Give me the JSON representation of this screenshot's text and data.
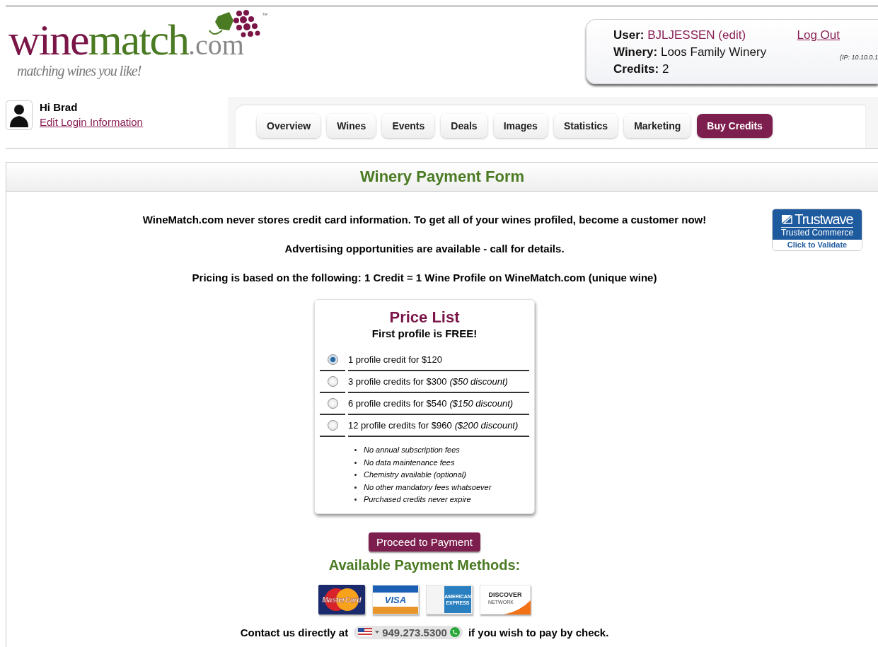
{
  "logo": {
    "wine": "wine",
    "match": "match",
    "com": ".com",
    "tm": "™",
    "tagline": "matching wines you like!"
  },
  "account": {
    "user_label": "User:",
    "user_name": "BJLJESSEN (edit)",
    "winery_label": "Winery:",
    "winery": "Loos Family Winery",
    "credits_label": "Credits:",
    "credits": "2",
    "logout": "Log Out",
    "ip": "(IP: 10.10.0.1"
  },
  "greeting": {
    "hello": "Hi Brad",
    "edit_login": "Edit Login Information"
  },
  "tabs": [
    {
      "label": "Overview",
      "selected": false
    },
    {
      "label": "Wines",
      "selected": false
    },
    {
      "label": "Events",
      "selected": false
    },
    {
      "label": "Deals",
      "selected": false
    },
    {
      "label": "Images",
      "selected": false
    },
    {
      "label": "Statistics",
      "selected": false
    },
    {
      "label": "Marketing",
      "selected": false
    },
    {
      "label": "Buy Credits",
      "selected": true
    }
  ],
  "form_title": "Winery Payment Form",
  "intro": [
    "WineMatch.com never stores credit card information. To get all of your wines profiled, become a customer now!",
    "Advertising opportunities are available - call for details.",
    "Pricing is based on the following: 1 Credit = 1 Wine Profile on WineMatch.com (unique wine)"
  ],
  "trust_badge": {
    "brand": "Trustwave",
    "subtitle": "Trusted Commerce",
    "action": "Click to Validate"
  },
  "price_list": {
    "title": "Price List",
    "subtitle": "First profile is FREE!",
    "options": [
      {
        "text": "1 profile credit for $120",
        "selected": true
      },
      {
        "text": "3 profile credits for $300 *($50 discount)*",
        "selected": false
      },
      {
        "text": "6 profile credits for $540 *($150 discount)*",
        "selected": false
      },
      {
        "text": "12 profile credits for $960 *($200 discount)*",
        "selected": false
      }
    ],
    "features": [
      "No annual subscription fees",
      "No data maintenance fees",
      "Chemistry available (optional)",
      "No other mandatory fees whatsoever",
      "Purchased credits never expire"
    ]
  },
  "proceed_button": "Proceed to Payment",
  "methods_title": "Available Payment Methods:",
  "cards": [
    {
      "kind": "mastercard",
      "label": "MasterCard"
    },
    {
      "kind": "visa",
      "label": "VISA"
    },
    {
      "kind": "amex",
      "label": "AMERICAN",
      "sublabel": "EXPRESS"
    },
    {
      "kind": "discover",
      "label": "DISCOVER",
      "sublabel": "NETWORK"
    }
  ],
  "contact": {
    "before": "Contact us directly at",
    "phone": "949.273.5300",
    "after": "if you wish to pay by check."
  }
}
